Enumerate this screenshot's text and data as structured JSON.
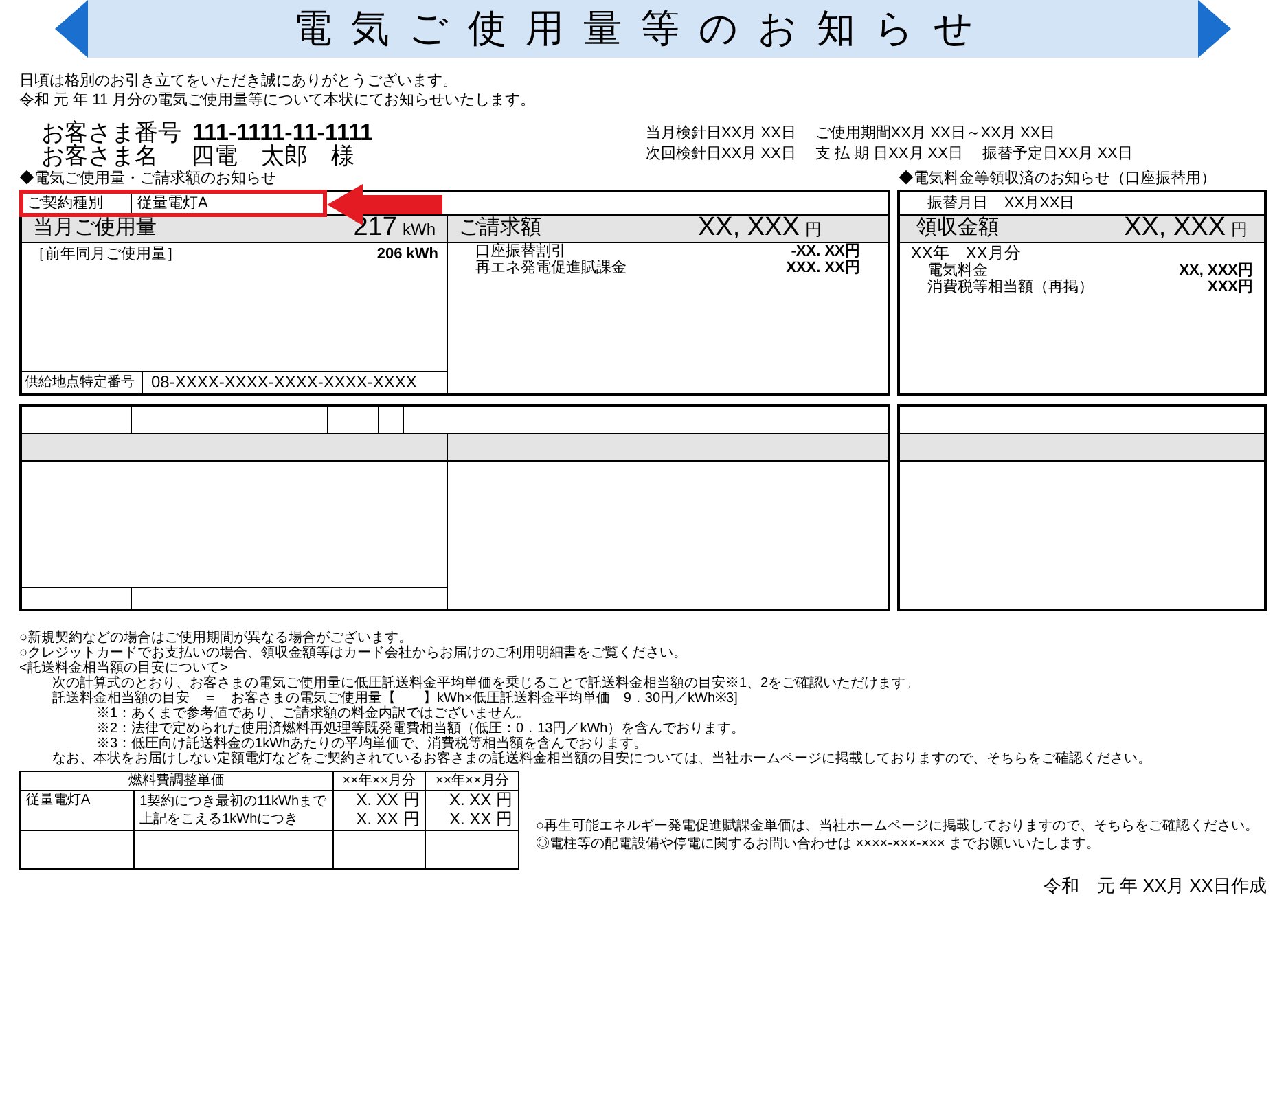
{
  "title": "電気ご使用量等のお知らせ",
  "greeting": [
    "日頃は格別のお引き立てをいただき誠にありがとうございます。",
    "令和 元 年 11 月分の電気ご使用量等について本状にてお知らせいたします。"
  ],
  "customer": {
    "number_label": "お客さま番号",
    "number": "111-1111-11-1111",
    "name_label": "お客さま名",
    "name": "四電　太郎　様"
  },
  "meter_dates": [
    [
      {
        "label": "当月検針日",
        "value": "XX月 XX日"
      },
      {
        "label": "ご使用期間",
        "value": "XX月 XX日～XX月 XX日"
      }
    ],
    [
      {
        "label": "次回検針日",
        "value": "XX月 XX日"
      },
      {
        "label": "支 払 期 日",
        "value": "XX月 XX日"
      },
      {
        "label": "振替予定日",
        "value": "XX月 XX日"
      }
    ]
  ],
  "usage_section": {
    "heading": "◆電気ご使用量・ご請求額のお知らせ",
    "contract_label": "ご契約種別",
    "contract_value": "従量電灯A",
    "usage_label": "当月ご使用量",
    "usage_value": "217",
    "usage_unit": "kWh",
    "prev_label": "［前年同月ご使用量］",
    "prev_value": "206 kWh",
    "supply_point_label": "供給地点特定番号",
    "supply_point": "08-XXXX-XXXX-XXXX-XXXX-XXXX",
    "billing_label": "ご請求額",
    "billing_value": "XX, XXX",
    "billing_unit": "円",
    "billing_items": [
      {
        "label": "口座振替割引",
        "amount": "-XX. XX円"
      },
      {
        "label": "再エネ発電促進賦課金",
        "amount": "XXX. XX円"
      }
    ]
  },
  "receipt_section": {
    "heading": "◆電気料金等領収済のお知らせ（口座振替用）",
    "transfer_date_label": "振替月日",
    "transfer_date": "XX月XX日",
    "amount_label": "領収金額",
    "amount": "XX, XXX",
    "unit": "円",
    "period": "XX年　XX月分",
    "items": [
      {
        "label": "電気料金",
        "amount": "XX, XXX円"
      },
      {
        "label": "消費税等相当額（再掲）",
        "amount": "XXX円"
      }
    ]
  },
  "notes": [
    {
      "text": "○新規契約などの場合はご使用期間が異なる場合がございます。"
    },
    {
      "text": "○クレジットカードでお支払いの場合、領収金額等はカード会社からお届けのご利用明細書をご覧ください。"
    },
    {
      "text": "<託送料金相当額の目安について>",
      "children": [
        {
          "text": "次の計算式のとおり、お客さまの電気ご使用量に低圧託送料金平均単価を乗じることで託送料金相当額の目安※1、2をご確認いただけます。"
        },
        {
          "text": "託送料金相当額の目安　＝　お客さまの電気ご使用量【　　】kWh×低圧託送料金平均単価　9．30円／kWh※3]",
          "children": [
            {
              "text": "※1：あくまで参考値であり、ご請求額の料金内訳ではございません。"
            },
            {
              "text": "※2：法律で定められた使用済燃料再処理等既発電費相当額（低圧：0．13円／kWh）を含んでおります。"
            },
            {
              "text": "※3：低圧向け託送料金の1kWhあたりの平均単価で、消費税等相当額を含んでおります。"
            }
          ]
        },
        {
          "text": "なお、本状をお届けしない定額電灯などをご契約されているお客さまの託送料金相当額の目安については、当社ホームページに掲載しておりますので、そちらをご確認ください。"
        }
      ]
    }
  ],
  "fuel_table": {
    "columns": [
      "燃料費調整単価",
      "××年××月分",
      "××年××月分"
    ],
    "rows": [
      {
        "plan": "従量電灯A",
        "tiers": [
          {
            "label": "1契約につき最初の11kWhまで",
            "prices": [
              "X. XX 円",
              "X. XX 円"
            ]
          },
          {
            "label": "上記をこえる1kWhにつき",
            "prices": [
              "X. XX 円",
              "X. XX 円"
            ]
          }
        ]
      }
    ]
  },
  "footer_notes": [
    "○再生可能エネルギー発電促進賦課金単価は、当社ホームページに掲載しておりますので、そちらをご確認ください。",
    "◎電柱等の配電設備や停電に関するお問い合わせは ××××-×××-××× までお願いいたします。"
  ],
  "created_date": "令和　元 年 XX月 XX日作成"
}
